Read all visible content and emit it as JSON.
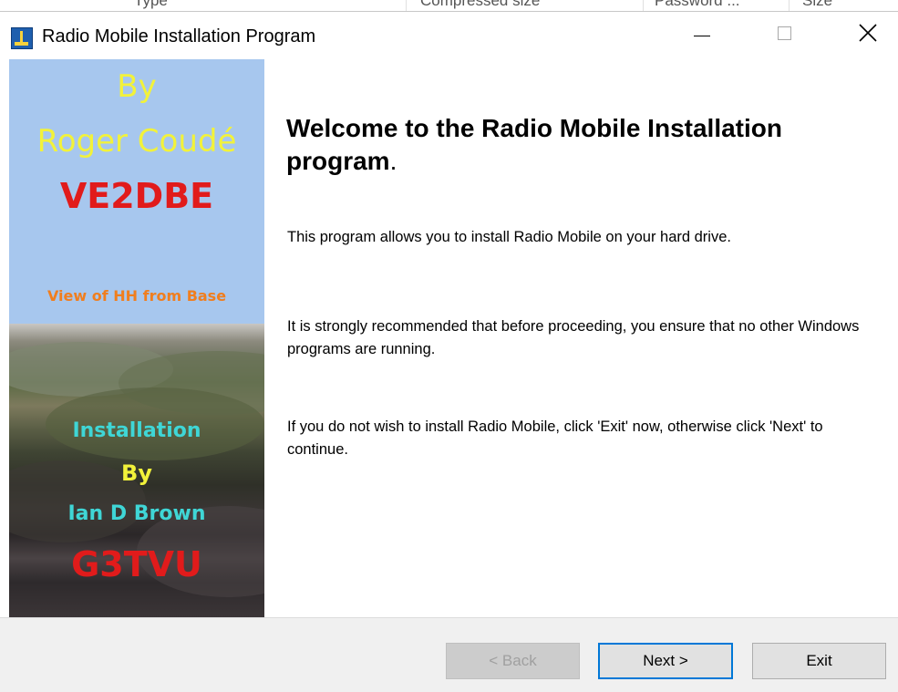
{
  "background_window": {
    "columns": [
      "Type",
      "Compressed size",
      "Password ...",
      "Size"
    ]
  },
  "window": {
    "title": "Radio Mobile Installation Program",
    "icon": "radio-mast-app-icon",
    "controls": {
      "minimize": "minimize-icon",
      "maximize": "maximize-icon",
      "close": "close-icon"
    }
  },
  "banner": {
    "line1": "By",
    "line2": "Roger Coudé",
    "line3": "VE2DBE",
    "caption": "View of HH from Base",
    "line4": "Installation",
    "line5": "By",
    "line6": "Ian D Brown",
    "line7": "G3TVU",
    "colors": {
      "sky": "#a7c7ee",
      "yellow": "#f2f23a",
      "red": "#e11b1b",
      "orange": "#f07e1e",
      "cyan": "#3fd6d6"
    }
  },
  "content": {
    "heading": "Welcome to the Radio Mobile Installation program",
    "heading_suffix": ".",
    "paragraph1": "This program allows you to install Radio Mobile on your hard drive.",
    "paragraph2": "It is strongly recommended that before proceeding, you ensure that no other Windows programs are running.",
    "paragraph3": "If you do not wish to install Radio Mobile, click 'Exit' now, otherwise click 'Next' to continue."
  },
  "buttons": {
    "back": "< Back",
    "next": "Next >",
    "exit": "Exit",
    "focus_color": "#0078d7"
  }
}
